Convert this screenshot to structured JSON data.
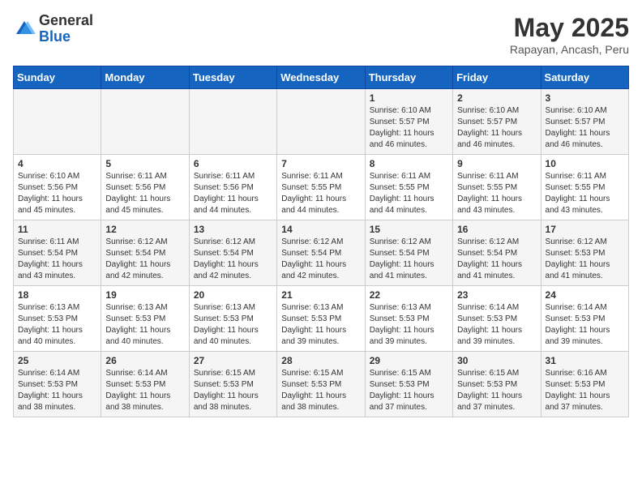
{
  "logo": {
    "general": "General",
    "blue": "Blue"
  },
  "title": "May 2025",
  "subtitle": "Rapayan, Ancash, Peru",
  "headers": [
    "Sunday",
    "Monday",
    "Tuesday",
    "Wednesday",
    "Thursday",
    "Friday",
    "Saturday"
  ],
  "weeks": [
    [
      {
        "day": "",
        "info": ""
      },
      {
        "day": "",
        "info": ""
      },
      {
        "day": "",
        "info": ""
      },
      {
        "day": "",
        "info": ""
      },
      {
        "day": "1",
        "info": "Sunrise: 6:10 AM\nSunset: 5:57 PM\nDaylight: 11 hours\nand 46 minutes."
      },
      {
        "day": "2",
        "info": "Sunrise: 6:10 AM\nSunset: 5:57 PM\nDaylight: 11 hours\nand 46 minutes."
      },
      {
        "day": "3",
        "info": "Sunrise: 6:10 AM\nSunset: 5:57 PM\nDaylight: 11 hours\nand 46 minutes."
      }
    ],
    [
      {
        "day": "4",
        "info": "Sunrise: 6:10 AM\nSunset: 5:56 PM\nDaylight: 11 hours\nand 45 minutes."
      },
      {
        "day": "5",
        "info": "Sunrise: 6:11 AM\nSunset: 5:56 PM\nDaylight: 11 hours\nand 45 minutes."
      },
      {
        "day": "6",
        "info": "Sunrise: 6:11 AM\nSunset: 5:56 PM\nDaylight: 11 hours\nand 44 minutes."
      },
      {
        "day": "7",
        "info": "Sunrise: 6:11 AM\nSunset: 5:55 PM\nDaylight: 11 hours\nand 44 minutes."
      },
      {
        "day": "8",
        "info": "Sunrise: 6:11 AM\nSunset: 5:55 PM\nDaylight: 11 hours\nand 44 minutes."
      },
      {
        "day": "9",
        "info": "Sunrise: 6:11 AM\nSunset: 5:55 PM\nDaylight: 11 hours\nand 43 minutes."
      },
      {
        "day": "10",
        "info": "Sunrise: 6:11 AM\nSunset: 5:55 PM\nDaylight: 11 hours\nand 43 minutes."
      }
    ],
    [
      {
        "day": "11",
        "info": "Sunrise: 6:11 AM\nSunset: 5:54 PM\nDaylight: 11 hours\nand 43 minutes."
      },
      {
        "day": "12",
        "info": "Sunrise: 6:12 AM\nSunset: 5:54 PM\nDaylight: 11 hours\nand 42 minutes."
      },
      {
        "day": "13",
        "info": "Sunrise: 6:12 AM\nSunset: 5:54 PM\nDaylight: 11 hours\nand 42 minutes."
      },
      {
        "day": "14",
        "info": "Sunrise: 6:12 AM\nSunset: 5:54 PM\nDaylight: 11 hours\nand 42 minutes."
      },
      {
        "day": "15",
        "info": "Sunrise: 6:12 AM\nSunset: 5:54 PM\nDaylight: 11 hours\nand 41 minutes."
      },
      {
        "day": "16",
        "info": "Sunrise: 6:12 AM\nSunset: 5:54 PM\nDaylight: 11 hours\nand 41 minutes."
      },
      {
        "day": "17",
        "info": "Sunrise: 6:12 AM\nSunset: 5:53 PM\nDaylight: 11 hours\nand 41 minutes."
      }
    ],
    [
      {
        "day": "18",
        "info": "Sunrise: 6:13 AM\nSunset: 5:53 PM\nDaylight: 11 hours\nand 40 minutes."
      },
      {
        "day": "19",
        "info": "Sunrise: 6:13 AM\nSunset: 5:53 PM\nDaylight: 11 hours\nand 40 minutes."
      },
      {
        "day": "20",
        "info": "Sunrise: 6:13 AM\nSunset: 5:53 PM\nDaylight: 11 hours\nand 40 minutes."
      },
      {
        "day": "21",
        "info": "Sunrise: 6:13 AM\nSunset: 5:53 PM\nDaylight: 11 hours\nand 39 minutes."
      },
      {
        "day": "22",
        "info": "Sunrise: 6:13 AM\nSunset: 5:53 PM\nDaylight: 11 hours\nand 39 minutes."
      },
      {
        "day": "23",
        "info": "Sunrise: 6:14 AM\nSunset: 5:53 PM\nDaylight: 11 hours\nand 39 minutes."
      },
      {
        "day": "24",
        "info": "Sunrise: 6:14 AM\nSunset: 5:53 PM\nDaylight: 11 hours\nand 39 minutes."
      }
    ],
    [
      {
        "day": "25",
        "info": "Sunrise: 6:14 AM\nSunset: 5:53 PM\nDaylight: 11 hours\nand 38 minutes."
      },
      {
        "day": "26",
        "info": "Sunrise: 6:14 AM\nSunset: 5:53 PM\nDaylight: 11 hours\nand 38 minutes."
      },
      {
        "day": "27",
        "info": "Sunrise: 6:15 AM\nSunset: 5:53 PM\nDaylight: 11 hours\nand 38 minutes."
      },
      {
        "day": "28",
        "info": "Sunrise: 6:15 AM\nSunset: 5:53 PM\nDaylight: 11 hours\nand 38 minutes."
      },
      {
        "day": "29",
        "info": "Sunrise: 6:15 AM\nSunset: 5:53 PM\nDaylight: 11 hours\nand 37 minutes."
      },
      {
        "day": "30",
        "info": "Sunrise: 6:15 AM\nSunset: 5:53 PM\nDaylight: 11 hours\nand 37 minutes."
      },
      {
        "day": "31",
        "info": "Sunrise: 6:16 AM\nSunset: 5:53 PM\nDaylight: 11 hours\nand 37 minutes."
      }
    ]
  ]
}
